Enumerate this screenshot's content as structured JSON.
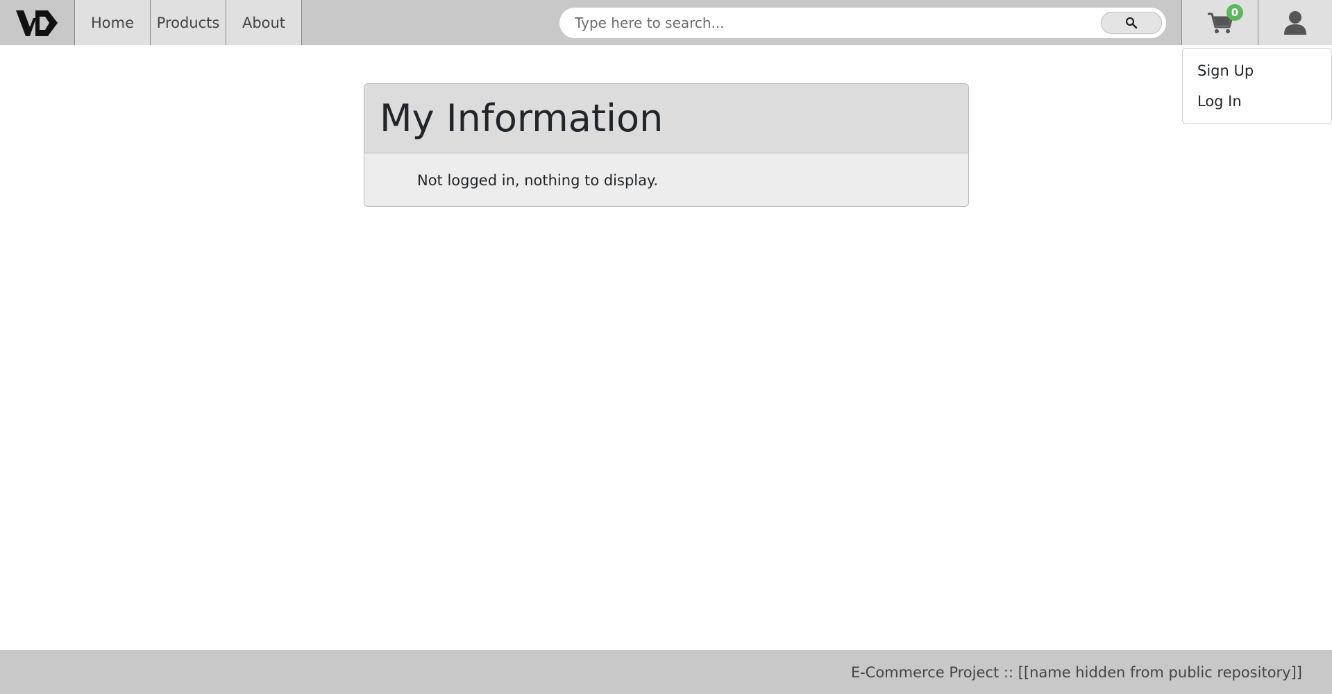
{
  "logo": {
    "text": "VD"
  },
  "nav": {
    "home": "Home",
    "products": "Products",
    "about": "About"
  },
  "search": {
    "placeholder": "Type here to search...",
    "icon": "search-icon"
  },
  "cart": {
    "count": "0",
    "icon": "cart-icon",
    "badge_color": "#5cb85c"
  },
  "user": {
    "icon": "user-icon"
  },
  "dropdown": {
    "items": [
      {
        "label": "Sign Up"
      },
      {
        "label": "Log In"
      }
    ]
  },
  "card": {
    "title": "My Information",
    "message": "Not logged in, nothing to display."
  },
  "footer": {
    "text": "E-Commerce Project :: [[name hidden from public repository]]"
  }
}
